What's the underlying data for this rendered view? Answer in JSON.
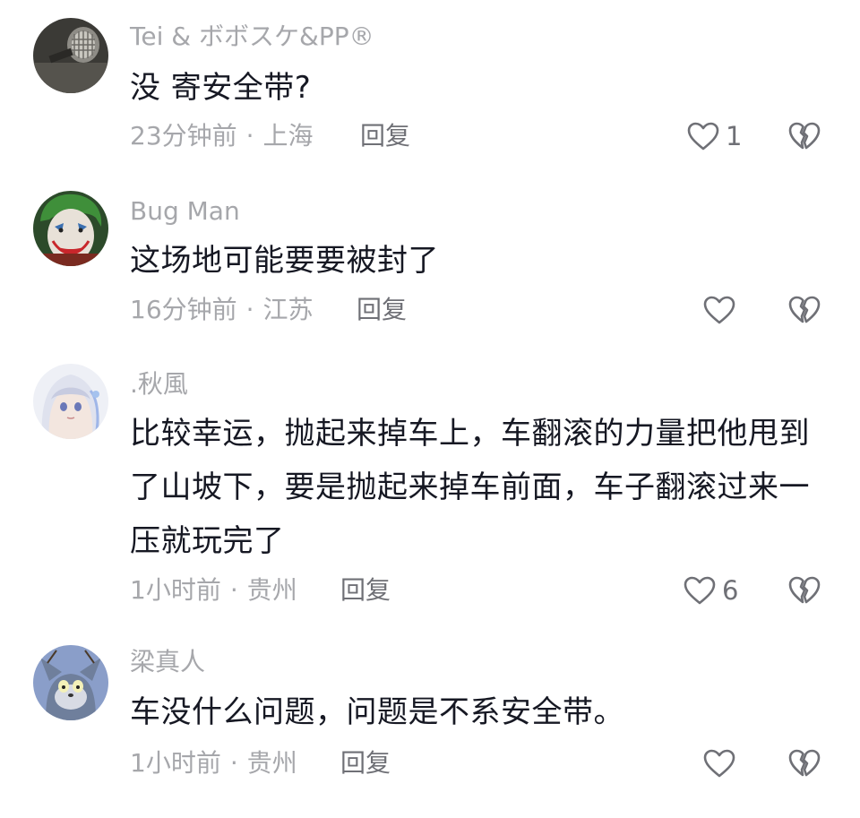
{
  "comments": [
    {
      "username": "Tei & ボボスケ&PP®",
      "text": "没 寄安全带?",
      "time": "23分钟前",
      "location": "上海",
      "reply_label": "回复",
      "likes": "1"
    },
    {
      "username": "Bug Man",
      "text": "这场地可能要要被封了",
      "time": "16分钟前",
      "location": "江苏",
      "reply_label": "回复",
      "likes": ""
    },
    {
      "username": ".秋風",
      "text": "比较幸运，抛起来掉车上，车翻滚的力量把他甩到了山坡下，要是抛起来掉车前面，车子翻滚过来一压就玩完了",
      "time": "1小时前",
      "location": "贵州",
      "reply_label": "回复",
      "likes": "6"
    },
    {
      "username": "梁真人",
      "text": "车没什么问题，问题是不系安全带。",
      "time": "1小时前",
      "location": "贵州",
      "reply_label": "回复",
      "likes": ""
    }
  ],
  "separator": "·",
  "icons": {
    "like": "heart-outline-icon",
    "dislike": "broken-heart-icon"
  },
  "colors": {
    "text_primary": "#161823",
    "text_secondary": "#a6a7ab",
    "reply": "#6f7076",
    "icon": "#6f7076"
  }
}
